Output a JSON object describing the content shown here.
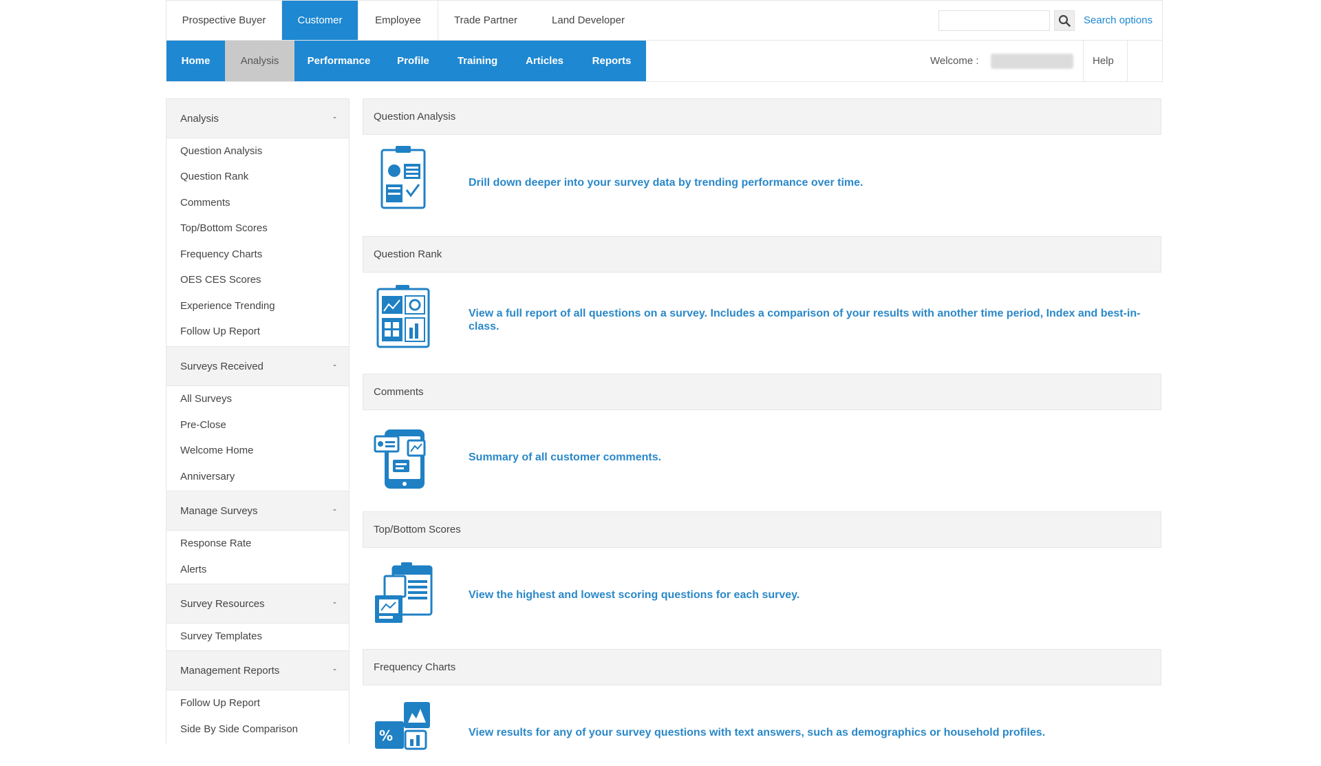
{
  "audience_tabs": [
    {
      "label": "Prospective Buyer",
      "active": false
    },
    {
      "label": "Customer",
      "active": true
    },
    {
      "label": "Employee",
      "active": false
    },
    {
      "label": "Trade Partner",
      "active": false
    },
    {
      "label": "Land Developer",
      "active": false
    }
  ],
  "search": {
    "placeholder": "",
    "options_label": "Search options",
    "icon": "search-icon"
  },
  "nav": [
    {
      "label": "Home",
      "active": false
    },
    {
      "label": "Analysis",
      "active": true
    },
    {
      "label": "Performance",
      "active": false
    },
    {
      "label": "Profile",
      "active": false
    },
    {
      "label": "Training",
      "active": false
    },
    {
      "label": "Articles",
      "active": false
    },
    {
      "label": "Reports",
      "active": false
    }
  ],
  "user": {
    "welcome_label": "Welcome :",
    "help_label": "Help"
  },
  "sidebar": {
    "toggle": "-",
    "sections": [
      {
        "title": "Analysis",
        "items": [
          "Question Analysis",
          "Question Rank",
          "Comments",
          "Top/Bottom Scores",
          "Frequency Charts",
          "OES CES Scores",
          "Experience Trending",
          "Follow Up Report"
        ]
      },
      {
        "title": "Surveys Received",
        "items": [
          "All Surveys",
          "Pre-Close",
          "Welcome Home",
          "Anniversary"
        ]
      },
      {
        "title": "Manage Surveys",
        "items": [
          "Response Rate",
          "Alerts"
        ]
      },
      {
        "title": "Survey Resources",
        "items": [
          "Survey Templates"
        ]
      },
      {
        "title": "Management Reports",
        "items": [
          "Follow Up Report",
          "Side By Side Comparison"
        ]
      }
    ]
  },
  "panels": [
    {
      "title": "Question Analysis",
      "description": "Drill down deeper into your survey data by trending performance over time.",
      "icon": "clipboard-chart-icon"
    },
    {
      "title": "Question Rank",
      "description": "View a full report of all questions on a survey. Includes a comparison of your results with another time period, Index and best-in-class.",
      "icon": "report-grid-icon"
    },
    {
      "title": "Comments",
      "description": "Summary of all customer comments.",
      "icon": "tablet-comments-icon"
    },
    {
      "title": "Top/Bottom Scores",
      "description": "View the highest and lowest scoring questions for each survey.",
      "icon": "stacked-reports-icon"
    },
    {
      "title": "Frequency Charts",
      "description": "View results for any of your survey questions with text answers, such as demographics or household profiles.",
      "icon": "frequency-chart-icon"
    }
  ],
  "colors": {
    "accent": "#1e88d2",
    "link_text": "#2a88c8",
    "header_bg": "#f3f3f3",
    "icon_blue": "#1f80c4"
  }
}
